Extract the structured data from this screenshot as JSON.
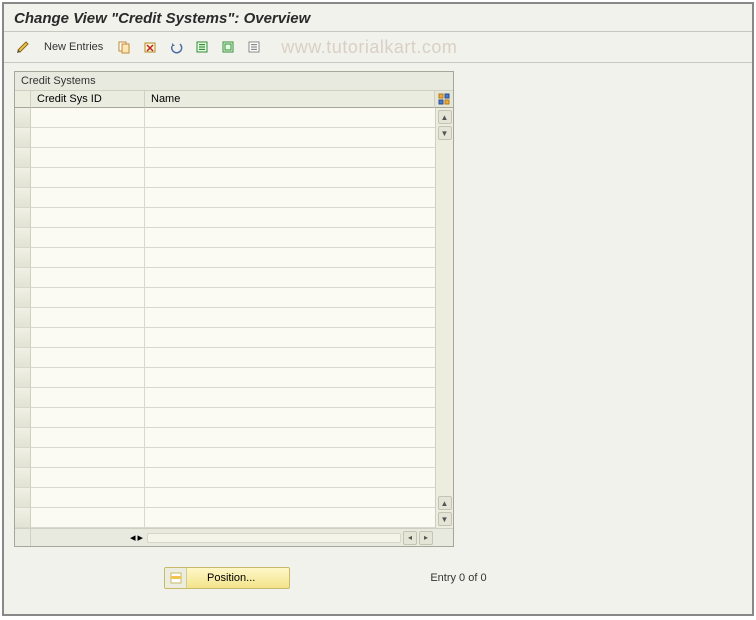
{
  "header": {
    "title": "Change View \"Credit Systems\": Overview"
  },
  "toolbar": {
    "new_entries_label": "New Entries"
  },
  "watermark": "www.tutorialkart.com",
  "table": {
    "title": "Credit Systems",
    "col1": "Credit Sys ID",
    "col2": "Name",
    "rows": []
  },
  "footer": {
    "position_label": "Position...",
    "entry_text": "Entry 0 of 0"
  }
}
